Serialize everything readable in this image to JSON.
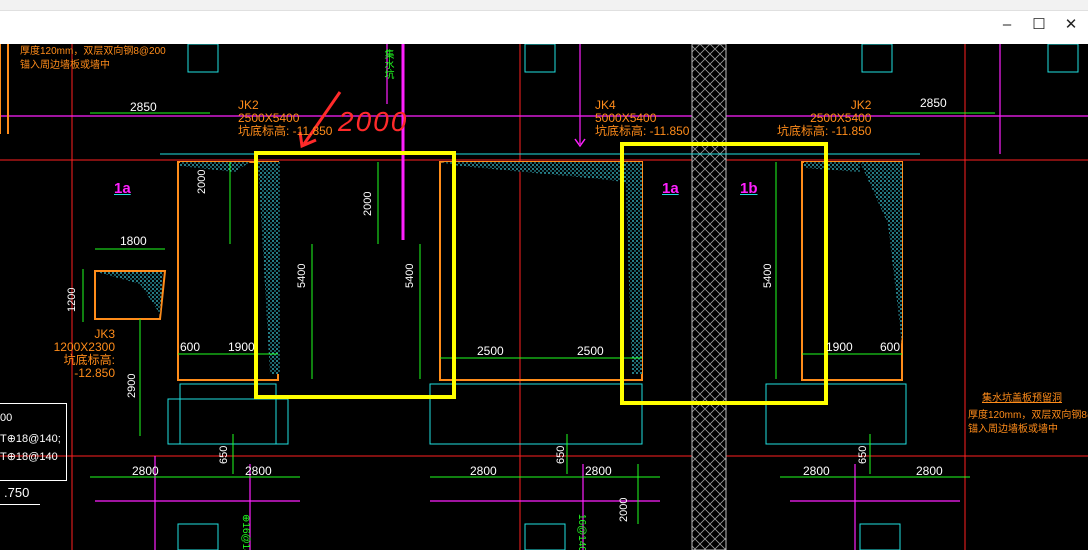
{
  "window": {
    "minimize_glyph": "–",
    "maximize_glyph": "☐",
    "close_glyph": "✕",
    "mini_glyph": "–"
  },
  "drawing": {
    "top_note_line1": "厚度120mm，双层双向钢8@200",
    "top_note_line2": "锚入周边墙板或墙中",
    "vertical_label_top": "集水坑",
    "dims": {
      "d2850_left": "2850",
      "d2850_right": "2850",
      "d1800": "1800",
      "d1200": "1200",
      "d2900": "2900",
      "d2000_a": "2000",
      "d2000_b": "2000",
      "d5400_a": "5400",
      "d5400_b": "5400",
      "d5400_c": "5400",
      "d600_left": "600",
      "d1900_left": "1900",
      "d2500_a": "2500",
      "d2500_b": "2500",
      "d1900_right": "1900",
      "d600_right": "600",
      "d2800_1": "2800",
      "d2800_2": "2800",
      "d2800_3": "2800",
      "d2800_4": "2800",
      "d2800_5": "2800",
      "d2800_6": "2800",
      "d650_1": "650",
      "d650_2": "650",
      "d650_3": "650",
      "d2000_bottom": "2000"
    },
    "jk2_left": {
      "name": "JK2",
      "size": "2500X5400",
      "elev": "坑底标高: -11.850"
    },
    "jk4": {
      "name": "JK4",
      "size": "5000X5400",
      "elev": "坑底标高: -11.850"
    },
    "jk2_right": {
      "name": "JK2",
      "size": "2500X5400",
      "elev": "坑底标高: -11.850"
    },
    "jk3": {
      "name": "JK3",
      "size": "1200X2300",
      "elev": "坑底标高: -12.850"
    },
    "section_1a_left": "1a",
    "section_1a_right": "1a",
    "section_1b": "1b",
    "handwritten": "2000",
    "right_note_title": "集水坑盖板预留洞",
    "right_note_line1": "厚度120mm，双层双向钢8@",
    "right_note_line2": "锚入周边墙板或墙中",
    "left_table": {
      "row1": "00",
      "row2": "T⊕18@140;",
      "row3": "T⊕18@140"
    },
    "left_elev": ".750",
    "rebar_label_1": "⊕16@140",
    "rebar_label_2": "16@140"
  },
  "colors": {
    "background": "#000000",
    "grid_red": "#ff2020",
    "magenta": "#ff20ff",
    "cyan": "#20e0e0",
    "green": "#20ff20",
    "orange": "#ff8c1a",
    "yellow_box": "#ffff00",
    "red_marker": "#ff2a2a"
  }
}
